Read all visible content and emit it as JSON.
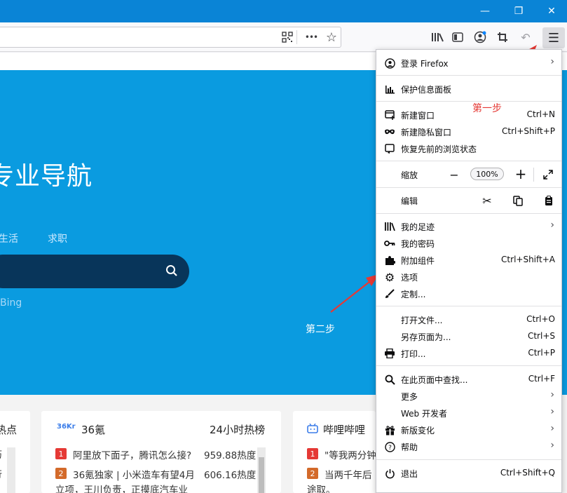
{
  "window": {
    "minimize": "—",
    "restore": "❐",
    "close": "✕"
  },
  "toolbar": {
    "more_dots": "•••"
  },
  "page": {
    "hero_title": "专业导航",
    "tabs": [
      "生活",
      "求职"
    ],
    "search_engine": "Bing"
  },
  "annotations": {
    "step1": "第一步",
    "step2": "第二步",
    "color": "#e53935"
  },
  "cards": [
    {
      "title": "热点",
      "items": []
    },
    {
      "logo": "36Kr",
      "title": "36氪",
      "right": "24小时热榜",
      "items": [
        {
          "rank": "1",
          "text": "阿里放下面子，腾讯怎么接?",
          "heat": "959.88热度",
          "color": "#e53935"
        },
        {
          "rank": "2",
          "text": "36氪独家 | 小米造车有望4月",
          "heat": "606.16热度",
          "color": "#d36a2a"
        },
        {
          "rank": "",
          "text": "立项，王川负责，正摸底汽车业",
          "heat": "",
          "color": ""
        }
      ]
    },
    {
      "title": "哔哩哔哩",
      "items": [
        {
          "rank": "1",
          "text": "\"等我两分钟",
          "color": "#e53935"
        },
        {
          "rank": "2",
          "text": "当两千年后",
          "color": "#d36a2a"
        },
        {
          "rank": "",
          "text": "途取。",
          "color": ""
        }
      ]
    }
  ],
  "menu": {
    "login": "登录 Firefox",
    "protection": "保护信息面板",
    "new_window": "新建窗口",
    "new_window_sc": "Ctrl+N",
    "private_window": "新建隐私窗口",
    "private_window_sc": "Ctrl+Shift+P",
    "restore_session": "恢复先前的浏览状态",
    "zoom": "缩放",
    "zoom_level": "100%",
    "edit": "编辑",
    "library": "我的足迹",
    "passwords": "我的密码",
    "addons": "附加组件",
    "addons_sc": "Ctrl+Shift+A",
    "options": "选项",
    "customize": "定制...",
    "open_file": "打开文件...",
    "open_file_sc": "Ctrl+O",
    "save_page": "另存页面为...",
    "save_page_sc": "Ctrl+S",
    "print": "打印...",
    "print_sc": "Ctrl+P",
    "find": "在此页面中查找...",
    "find_sc": "Ctrl+F",
    "more": "更多",
    "web_dev": "Web 开发者",
    "whats_new": "新版变化",
    "help": "帮助",
    "quit": "退出",
    "quit_sc": "Ctrl+Shift+Q"
  }
}
